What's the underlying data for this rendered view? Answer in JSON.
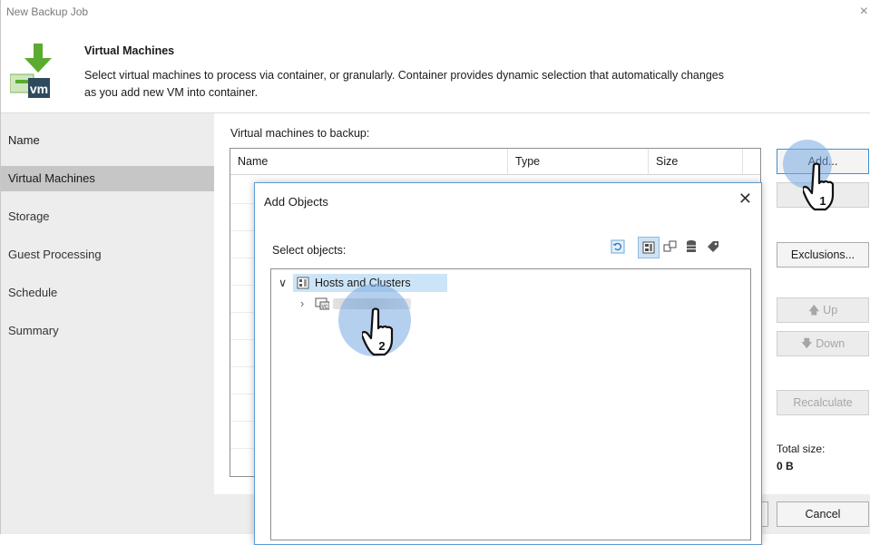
{
  "window": {
    "title": "New Backup Job",
    "close_glyph": "×"
  },
  "header": {
    "title": "Virtual Machines",
    "description_line1": "Select virtual machines to process via container, or granularly. Container provides dynamic selection that automatically changes",
    "description_line2": "as you add new VM into container.",
    "icon": "vm-download-icon",
    "icon_text": "vm"
  },
  "steps": [
    {
      "label": "Name"
    },
    {
      "label": "Virtual Machines"
    },
    {
      "label": "Storage"
    },
    {
      "label": "Guest Processing"
    },
    {
      "label": "Schedule"
    },
    {
      "label": "Summary"
    }
  ],
  "main": {
    "list_label": "Virtual machines to backup:",
    "columns": [
      "Name",
      "Type",
      "Size"
    ],
    "buttons": {
      "add": "Add...",
      "exclusions": "Exclusions...",
      "up": "Up",
      "down": "Down",
      "recalculate": "Recalculate"
    },
    "total_size_label": "Total size:",
    "total_size_value": "0 B"
  },
  "footer": {
    "cancel": "Cancel"
  },
  "dialog": {
    "title": "Add Objects",
    "select_label": "Select objects:",
    "toolbar_icons": [
      "refresh-icon",
      "hosts-and-clusters-view-icon",
      "vms-and-templates-view-icon",
      "datastores-view-icon",
      "tags-view-icon"
    ],
    "tree": {
      "root_label": "Hosts and Clusters",
      "child_icon": "vcenter-icon",
      "child_icon_text": "VC"
    }
  },
  "annotations": {
    "step1": "1",
    "step2": "2"
  },
  "colors": {
    "accent": "#3c8fd6",
    "sidebar_bg": "#ededed",
    "active_step_bg": "#c6c6c6",
    "selected_row_bg": "#cce4f7",
    "icon_green": "#5aab2f",
    "vm_badge_dark": "#2e4a5c"
  }
}
